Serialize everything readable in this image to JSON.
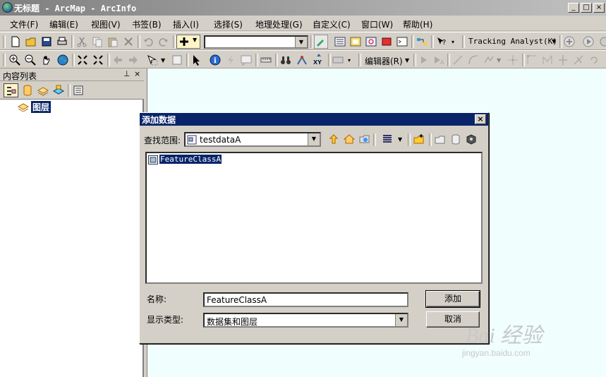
{
  "window": {
    "title": "无标题 - ArcMap - ArcInfo",
    "minimize": "_",
    "maximize": "□",
    "close": "×"
  },
  "menus": [
    "文件(F)",
    "编辑(E)",
    "视图(V)",
    "书签(B)",
    "插入(I)",
    "选择(S)",
    "地理处理(G)",
    "自定义(C)",
    "窗口(W)",
    "帮助(H)"
  ],
  "toolbar": {
    "tracking_analyst": "Tracking Analyst(K)",
    "editor": "编辑器(R)",
    "xy_label": "XY"
  },
  "toc": {
    "title": "内容列表",
    "layer_root": "图层"
  },
  "dialog": {
    "title": "添加数据",
    "lookin_label": "查找范围:",
    "lookin_value": "testdataA",
    "files": [
      "FeatureClassA"
    ],
    "name_label": "名称:",
    "name_value": "FeatureClassA",
    "type_label": "显示类型:",
    "type_value": "数据集和图层",
    "add_button": "添加",
    "cancel_button": "取消"
  },
  "watermark": {
    "brand": "Bai 经验",
    "url": "jingyan.baidu.com"
  },
  "colors": {
    "dialog_title_bg": "#0a246a",
    "map_bg": "#f0fefe",
    "chrome": "#d4d0c8"
  }
}
